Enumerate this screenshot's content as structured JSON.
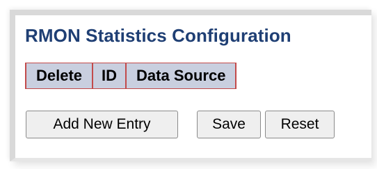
{
  "page": {
    "title": "RMON Statistics Configuration"
  },
  "table": {
    "headers": {
      "delete": "Delete",
      "id": "ID",
      "data_source": "Data Source"
    },
    "rows": []
  },
  "buttons": {
    "add_new_entry": "Add New Entry",
    "save": "Save",
    "reset": "Reset"
  },
  "colors": {
    "title": "#1f3f74",
    "table_header_bg": "#c9cfdf",
    "table_border": "#c24a4a",
    "button_bg": "#efefef"
  }
}
